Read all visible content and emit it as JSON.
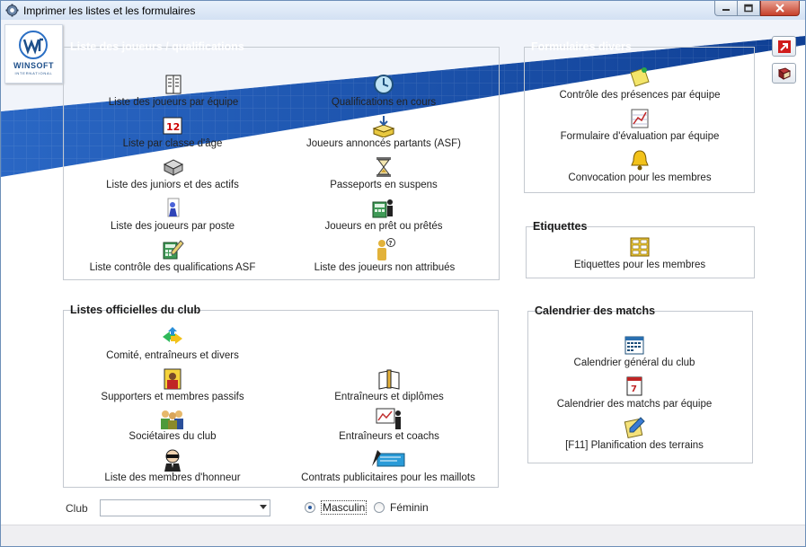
{
  "window": {
    "title": "Imprimer les listes et les formulaires"
  },
  "logo": {
    "name": "WINSOFT",
    "sub": "INTERNATIONAL"
  },
  "groups": {
    "joueurs": {
      "title": "Liste des joueurs / qualifications",
      "items": [
        "Liste des joueurs par équipe",
        "Qualifications en cours",
        "Liste par classe d'âge",
        "Joueurs annoncés partants (ASF)",
        "Liste des juniors et des actifs",
        "Passeports en suspens",
        "Liste des joueurs par poste",
        "Joueurs en prêt ou prêtés",
        "Liste contrôle des qualifications ASF",
        "Liste des joueurs non attribués"
      ]
    },
    "officielles": {
      "title": "Listes officielles du club",
      "items": [
        "Comité, entraîneurs et divers",
        "Supporters et membres passifs",
        "Entraîneurs et diplômes",
        "Sociétaires du club",
        "Entraîneurs et coachs",
        "Liste des membres d'honneur",
        "Contrats publicitaires pour les maillots"
      ]
    },
    "formulaires": {
      "title": "Formulaires divers",
      "items": [
        "Contrôle des présences par équipe",
        "Formulaire d'évaluation par équipe",
        "Convocation pour les membres"
      ]
    },
    "etiquettes": {
      "title": "Etiquettes",
      "items": [
        "Etiquettes pour les membres"
      ]
    },
    "calendrier": {
      "title": "Calendrier des matchs",
      "items": [
        "Calendrier général du club",
        "Calendrier des matchs par équipe",
        "[F11] Planification des terrains"
      ]
    }
  },
  "filters": {
    "club_label": "Club",
    "club_value": "",
    "gender_options": [
      "Masculin",
      "Féminin"
    ],
    "gender_selected": "Masculin"
  },
  "icons": {
    "exit": "exit-arrow-icon",
    "help": "book-icon"
  },
  "colors": {
    "banner_blue": "#1f57b5",
    "accent_red": "#d01c1c"
  }
}
